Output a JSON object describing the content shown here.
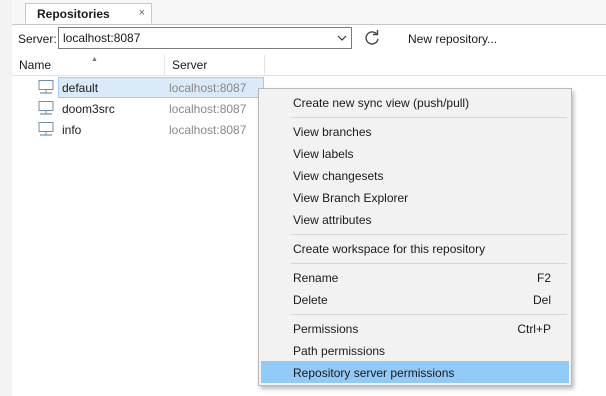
{
  "tab": {
    "label": "Repositories",
    "close": "×"
  },
  "server": {
    "label": "Server:",
    "value": "localhost:8087",
    "new_repo_label": "New repository..."
  },
  "columns": {
    "name": "Name",
    "server": "Server"
  },
  "rows": [
    {
      "name": "default",
      "server": "localhost:8087"
    },
    {
      "name": "doom3src",
      "server": "localhost:8087"
    },
    {
      "name": "info",
      "server": "localhost:8087"
    }
  ],
  "menu": {
    "create_sync": "Create new sync view (push/pull)",
    "view_branches": "View branches",
    "view_labels": "View labels",
    "view_changesets": "View changesets",
    "view_branch_explorer": "View Branch Explorer",
    "view_attributes": "View attributes",
    "create_workspace": "Create workspace for this repository",
    "rename": "Rename",
    "rename_shortcut": "F2",
    "delete": "Delete",
    "delete_shortcut": "Del",
    "permissions": "Permissions",
    "permissions_shortcut": "Ctrl+P",
    "path_permissions": "Path permissions",
    "repo_server_permissions": "Repository server permissions"
  },
  "colors": {
    "menu_highlight": "#91c9f7",
    "selection": "#dbeaf8"
  },
  "icons": {
    "repo": "monitor-icon",
    "refresh": "refresh-icon",
    "dropdown": "chevron-down-icon"
  }
}
